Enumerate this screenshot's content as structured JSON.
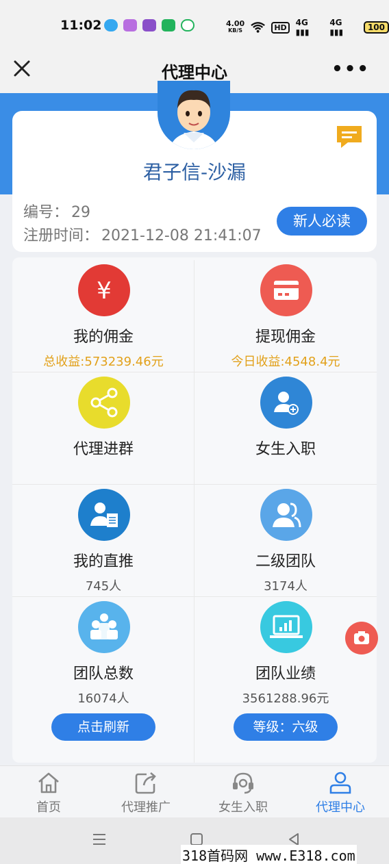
{
  "status_bar": {
    "time": "11:02",
    "speed_value": "4.00",
    "speed_unit": "KB/S",
    "hd": "HD",
    "signal1": "4G",
    "signal2": "4G",
    "battery": "100"
  },
  "header": {
    "title": "代理中心",
    "more": "•••"
  },
  "profile": {
    "nickname": "君子信-沙漏",
    "id_label": "编号：",
    "id_value": "29",
    "reg_label": "注册时间：",
    "reg_value": "2021-12-08 21:41:07",
    "read_button": "新人必读"
  },
  "menu": [
    {
      "label": "我的佣金",
      "sub": "总收益:573239.46元",
      "icon": "yen-icon",
      "color": "#e23a35"
    },
    {
      "label": "提现佣金",
      "sub": "今日收益:4548.4元",
      "icon": "card-icon",
      "color": "#ee5b52"
    },
    {
      "label": "代理进群",
      "sub": "",
      "icon": "share-icon",
      "color": "#e8dc2c"
    },
    {
      "label": "女生入职",
      "sub": "",
      "icon": "add-user-icon",
      "color": "#2f86d6"
    },
    {
      "label": "我的直推",
      "sub": "745人",
      "icon": "user-doc-icon",
      "color": "#1e7fcc"
    },
    {
      "label": "二级团队",
      "sub": "3174人",
      "icon": "users-icon",
      "color": "#5aa6e8"
    },
    {
      "label": "团队总数",
      "sub": "16074人",
      "icon": "team-icon",
      "color": "#58b3ec"
    },
    {
      "label": "团队业绩",
      "sub": "3561288.96元",
      "icon": "laptop-chart-icon",
      "color": "#38c9e0"
    }
  ],
  "actions": {
    "refresh": "点击刷新",
    "level": "等级：六级"
  },
  "tabs": [
    {
      "label": "首页",
      "icon": "home-icon"
    },
    {
      "label": "代理推广",
      "icon": "share-box-icon"
    },
    {
      "label": "女生入职",
      "icon": "headset-icon"
    },
    {
      "label": "代理中心",
      "icon": "person-icon"
    }
  ],
  "watermark": "318首码网 www.E318.com",
  "colors": {
    "accent": "#2f7fe6",
    "header_blue": "#3a8de6",
    "gold": "#e2a11b"
  }
}
